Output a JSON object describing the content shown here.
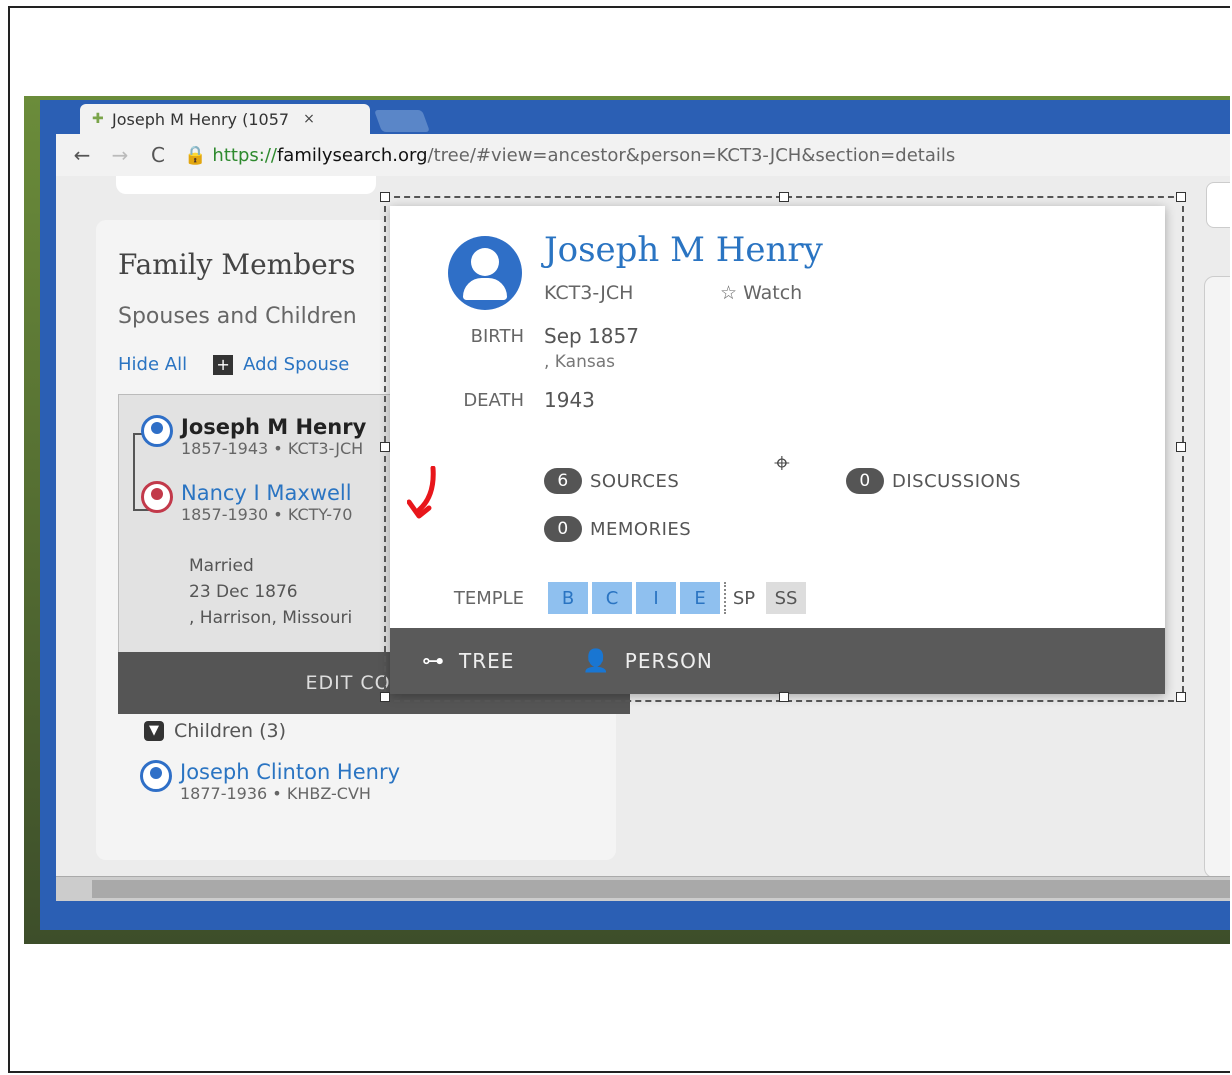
{
  "browser": {
    "tab_title": "Joseph M Henry (1057",
    "tab_close": "×",
    "url_https": "https://",
    "url_domain": "familysearch.org",
    "url_rest": "/tree/#view=ancestor&person=KCT3-JCH&section=details"
  },
  "family": {
    "title": "Family Members",
    "spouses_heading": "Spouses and Children",
    "hide_all": "Hide All",
    "add_spouse": "Add Spouse",
    "husband": {
      "name": "Joseph M Henry",
      "dates": "1857-1943 • KCT3-JCH"
    },
    "wife": {
      "name": "Nancy I Maxwell",
      "dates": "1857-1930 • KCTY-70"
    },
    "married_label": "Married",
    "married_date": "23 Dec 1876",
    "married_place": ", Harrison, Missouri",
    "edit_couple": "EDIT COUPLE",
    "children_label": "Children (3)",
    "child": {
      "name": "Joseph Clinton Henry",
      "dates": "1877-1936 • KHBZ-CVH"
    }
  },
  "popup": {
    "name": "Joseph M Henry",
    "pid": "KCT3-JCH",
    "watch": "☆ Watch",
    "birth_label": "BIRTH",
    "birth_date": "Sep 1857",
    "birth_place": ", Kansas",
    "death_label": "DEATH",
    "death_date": "1943",
    "sources_count": "6",
    "sources_label": "SOURCES",
    "discussions_count": "0",
    "discussions_label": "DISCUSSIONS",
    "memories_count": "0",
    "memories_label": "MEMORIES",
    "temple_label": "TEMPLE",
    "ordinances": [
      "B",
      "C",
      "I",
      "E"
    ],
    "sp": "SP",
    "ss": "SS",
    "tree_button": "TREE",
    "person_button": "PERSON"
  },
  "colors": {
    "accent": "#2a74c2",
    "female": "#c2394a",
    "annotation_arrow": "#e8161b"
  }
}
